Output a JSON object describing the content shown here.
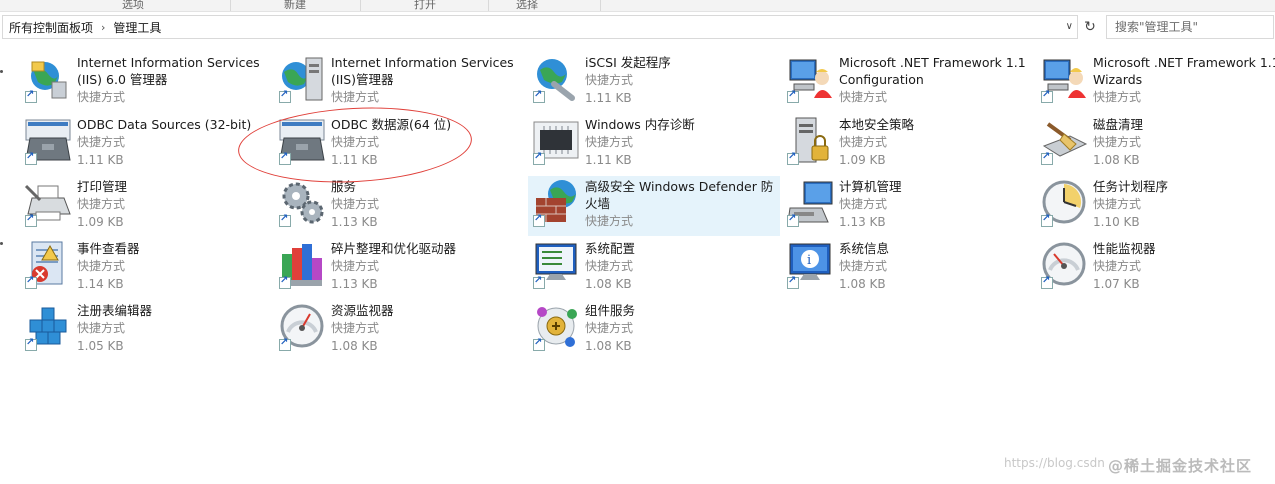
{
  "ribbon": {
    "items": [
      "选项",
      "新建",
      "打开",
      "选择"
    ]
  },
  "address": {
    "breadcrumb": [
      "所有控制面板项",
      "管理工具"
    ]
  },
  "search": {
    "placeholder": "搜索\"管理工具\""
  },
  "items": [
    {
      "name": "Internet Information Services (IIS) 6.0 管理器",
      "type": "快捷方式",
      "size": "",
      "icon": "iis6-globe-icon"
    },
    {
      "name": "Internet Information Services (IIS)管理器",
      "type": "快捷方式",
      "size": "",
      "icon": "iis-manager-icon"
    },
    {
      "name": "iSCSI 发起程序",
      "type": "快捷方式",
      "size": "1.11 KB",
      "icon": "iscsi-globe-icon"
    },
    {
      "name": "Microsoft .NET Framework 1.1 Configuration",
      "type": "快捷方式",
      "size": "",
      "icon": "dotnet-config-icon"
    },
    {
      "name": "Microsoft .NET Framework 1.1 Wizards",
      "type": "快捷方式",
      "size": "",
      "icon": "dotnet-wizard-icon"
    },
    {
      "name": "ODBC Data Sources (32-bit)",
      "type": "快捷方式",
      "size": "1.11 KB",
      "icon": "odbc-toolbox-icon"
    },
    {
      "name": "ODBC 数据源(64 位)",
      "type": "快捷方式",
      "size": "1.11 KB",
      "icon": "odbc-toolbox-icon"
    },
    {
      "name": "Windows 内存诊断",
      "type": "快捷方式",
      "size": "1.11 KB",
      "icon": "memory-chip-icon"
    },
    {
      "name": "本地安全策略",
      "type": "快捷方式",
      "size": "1.09 KB",
      "icon": "server-lock-icon"
    },
    {
      "name": "磁盘清理",
      "type": "快捷方式",
      "size": "1.08 KB",
      "icon": "disk-cleanup-icon"
    },
    {
      "name": "打印管理",
      "type": "快捷方式",
      "size": "1.09 KB",
      "icon": "printer-icon"
    },
    {
      "name": "服务",
      "type": "快捷方式",
      "size": "1.13 KB",
      "icon": "gears-icon"
    },
    {
      "name": "高级安全 Windows Defender 防火墙",
      "type": "快捷方式",
      "size": "",
      "icon": "firewall-icon"
    },
    {
      "name": "计算机管理",
      "type": "快捷方式",
      "size": "1.13 KB",
      "icon": "computer-management-icon"
    },
    {
      "name": "任务计划程序",
      "type": "快捷方式",
      "size": "1.10 KB",
      "icon": "clock-icon"
    },
    {
      "name": "事件查看器",
      "type": "快捷方式",
      "size": "1.14 KB",
      "icon": "event-viewer-icon"
    },
    {
      "name": "碎片整理和优化驱动器",
      "type": "快捷方式",
      "size": "1.13 KB",
      "icon": "defrag-icon"
    },
    {
      "name": "系统配置",
      "type": "快捷方式",
      "size": "1.08 KB",
      "icon": "system-config-icon"
    },
    {
      "name": "系统信息",
      "type": "快捷方式",
      "size": "1.08 KB",
      "icon": "system-info-icon"
    },
    {
      "name": "性能监视器",
      "type": "快捷方式",
      "size": "1.07 KB",
      "icon": "gauge-icon"
    },
    {
      "name": "注册表编辑器",
      "type": "快捷方式",
      "size": "1.05 KB",
      "icon": "registry-cubes-icon"
    },
    {
      "name": "资源监视器",
      "type": "快捷方式",
      "size": "1.08 KB",
      "icon": "gauge-icon"
    },
    {
      "name": "组件服务",
      "type": "快捷方式",
      "size": "1.08 KB",
      "icon": "component-services-icon"
    }
  ],
  "watermark": {
    "url": "https://blog.csdn",
    "brand": "@稀土掘金技术社区"
  }
}
